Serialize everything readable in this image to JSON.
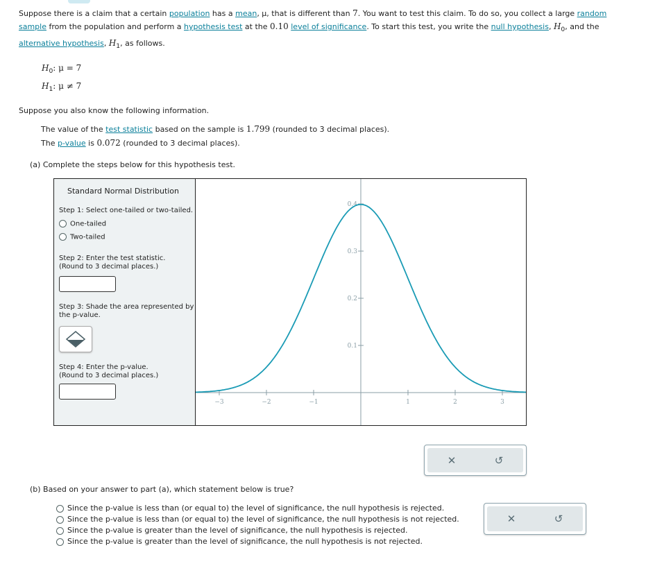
{
  "intro": {
    "p1": "Suppose there is a claim that a certain ",
    "population": "population",
    "p2": " has a ",
    "mean": "mean",
    "p3": ", μ, that is different than ",
    "seven": "7",
    "p4": ". You want to test this claim. To do so, you collect a large ",
    "random": "random",
    "sample": "sample",
    "p5": " from the population and perform a ",
    "hypothesis_test": "hypothesis test",
    "p6": " at the ",
    "alpha": "0.10",
    "p7": " ",
    "level": "level of significance",
    "p8": ". To start this test, you write the ",
    "null": "null hypothesis",
    "p9": ", ",
    "H0": "H",
    "H0sub": "0",
    "p10": ", and the",
    "alt": "alternative hypothesis",
    "p11": ", ",
    "H1": "H",
    "H1sub": "1",
    "p12": ", as follows."
  },
  "hypotheses": {
    "h0": {
      "sym": "H",
      "sub": "0",
      "rel": ": μ = 7"
    },
    "h1": {
      "sym": "H",
      "sub": "1",
      "rel": ": μ ≠ 7"
    }
  },
  "info": {
    "lead": "Suppose you also know the following information.",
    "ts1": "The value of the ",
    "ts_link": "test statistic",
    "ts2": " based on the sample is ",
    "ts_val": "1.799",
    "ts3": " (rounded to 3 decimal places).",
    "pv1": "The ",
    "pv_link": "p-value",
    "pv2": " is ",
    "pv_val": "0.072",
    "pv3": " (rounded to 3 decimal places)."
  },
  "part_a": {
    "label": "(a) Complete the steps below for this hypothesis test.",
    "panel_title": "Standard Normal Distribution",
    "step1": "Step 1: Select one-tailed or two-tailed.",
    "one_tailed": "One-tailed",
    "two_tailed": "Two-tailed",
    "step2a": "Step 2: Enter the test statistic.",
    "step2b": "(Round to 3 decimal places.)",
    "step3a": "Step 3: Shade the area represented by",
    "step3b": "the p-value.",
    "step4a": "Step 4: Enter the p-value.",
    "step4b": "(Round to 3 decimal places.)",
    "test_statistic_value": "",
    "p_value_value": ""
  },
  "chart_data": {
    "type": "line",
    "function": "standard normal density",
    "xlim": [
      -3.5,
      3.5
    ],
    "ylim": [
      0,
      0.4
    ],
    "x_ticks": [
      "−3",
      "−2",
      "−1",
      "1",
      "2",
      "3"
    ],
    "y_ticks": [
      "0.1",
      "0.2",
      "0.3",
      "0.4"
    ],
    "line_color": "#1a9bb5",
    "grid": false
  },
  "buttons": {
    "clear_icon": "x-icon",
    "undo_icon": "undo-icon"
  },
  "part_b": {
    "label": "(b) Based on your answer to part (a), which statement below is true?",
    "options": [
      "Since the p-value is less than (or equal to) the level of significance, the null hypothesis is rejected.",
      "Since the p-value is less than (or equal to) the level of significance, the null hypothesis is not rejected.",
      "Since the p-value is greater than the level of significance, the null hypothesis is rejected.",
      "Since the p-value is greater than the level of significance, the null hypothesis is not rejected."
    ]
  }
}
